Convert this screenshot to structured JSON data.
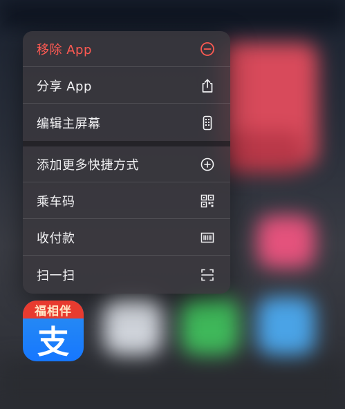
{
  "menu": {
    "items": [
      {
        "label": "移除 App",
        "icon": "minus-circle-icon",
        "danger": true
      },
      {
        "label": "分享 App",
        "icon": "share-icon"
      },
      {
        "label": "编辑主屏幕",
        "icon": "phone-icon"
      },
      {
        "label": "添加更多快捷方式",
        "icon": "plus-circle-icon"
      },
      {
        "label": "乘车码",
        "icon": "qr-code-icon"
      },
      {
        "label": "收付款",
        "icon": "barcode-icon"
      },
      {
        "label": "扫一扫",
        "icon": "scan-icon"
      }
    ]
  },
  "app": {
    "banner": "福相伴",
    "glyph": "支"
  },
  "colors": {
    "danger": "#ff5a52",
    "app_blue": "#1677ff",
    "banner_red": "#e83b2f"
  }
}
